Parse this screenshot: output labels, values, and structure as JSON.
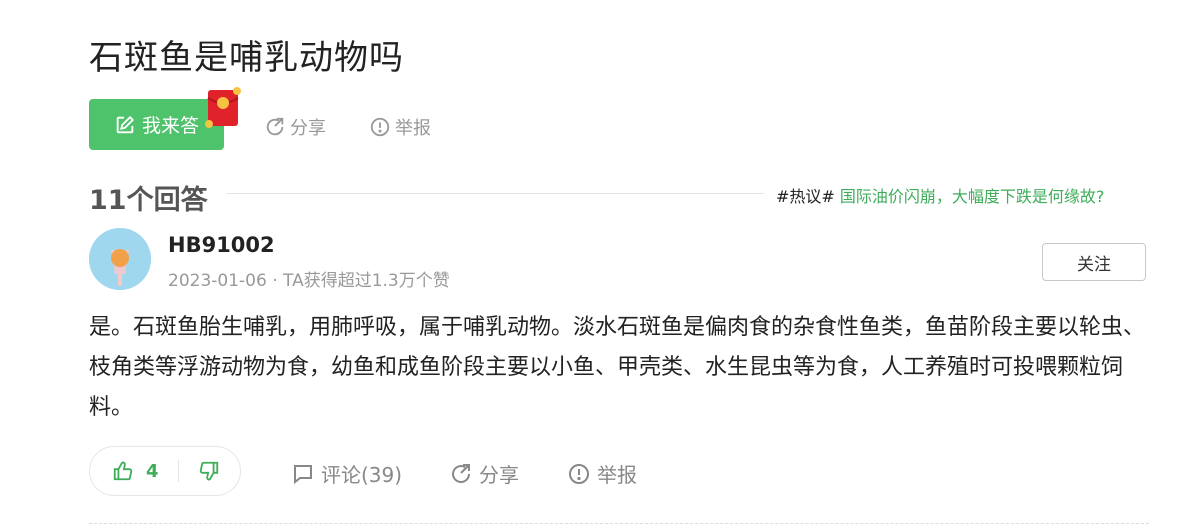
{
  "question": {
    "title": "石斑鱼是哺乳动物吗"
  },
  "actions": {
    "answer_label": "我来答",
    "share_label": "分享",
    "report_label": "举报"
  },
  "answers_header": {
    "count_label": "11个回答",
    "hot_tag": "#热议#",
    "hot_link": "国际油价闪崩，大幅度下跌是何缘故?"
  },
  "answer": {
    "username": "HB91002",
    "meta": "2023-01-06 · TA获得超过1.3万个赞",
    "follow_label": "关注",
    "content": "是。石斑鱼胎生哺乳，用肺呼吸，属于哺乳动物。淡水石斑鱼是偏肉食的杂食性鱼类，鱼苗阶段主要以轮虫、枝角类等浮游动物为食，幼鱼和成鱼阶段主要以小鱼、甲壳类、水生昆虫等为食，人工养殖时可投喂颗粒饲料。",
    "like_count": "4",
    "comment_label": "评论(39)",
    "share_label": "分享",
    "report_label": "举报"
  },
  "colors": {
    "brand_green": "#4fc26c",
    "link_green": "#3fad5a",
    "muted_gray": "#999999"
  },
  "icons": [
    "edit-icon",
    "red-packet-icon",
    "share-icon",
    "report-icon",
    "thumbs-up-icon",
    "thumbs-down-icon",
    "comment-icon"
  ]
}
